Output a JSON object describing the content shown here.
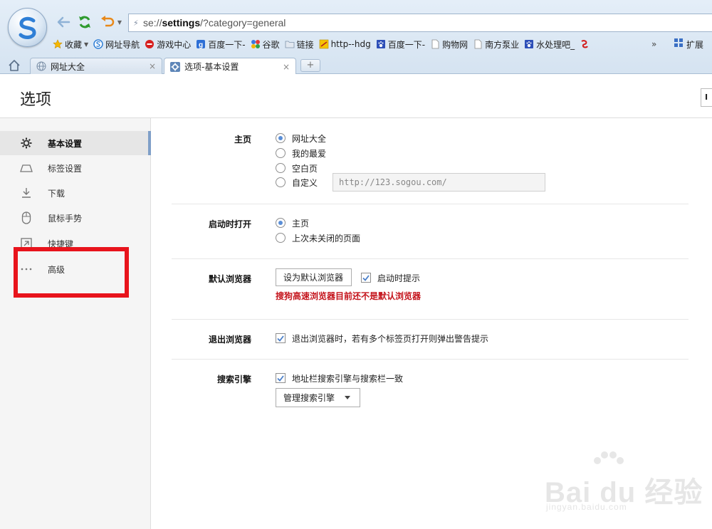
{
  "address_bar": {
    "url_prefix": "se://",
    "url_host": "settings",
    "url_path": "/?category=general"
  },
  "bookmarks": [
    {
      "label": "收藏",
      "icon": "star-icon"
    },
    {
      "label": "网址导航",
      "icon": "sogou-icon"
    },
    {
      "label": "游戏中心",
      "icon": "game-icon"
    },
    {
      "label": "百度一下-",
      "icon": "baidu-icon"
    },
    {
      "label": "谷歌",
      "icon": "google-icon"
    },
    {
      "label": "链接",
      "icon": "folder-icon"
    },
    {
      "label": "http--hdg",
      "icon": "site-icon"
    },
    {
      "label": "百度一下-",
      "icon": "baidu-paw-icon"
    },
    {
      "label": "购物网",
      "icon": "page-icon"
    },
    {
      "label": "南方泵业",
      "icon": "page-icon"
    },
    {
      "label": "水处理吧_",
      "icon": "baidu-paw-icon"
    }
  ],
  "bookmarks_more": "»",
  "extensions_label": "扩展",
  "tabs": [
    {
      "label": "网址大全",
      "icon": "globe-icon"
    },
    {
      "label": "选项-基本设置",
      "icon": "gear-icon"
    }
  ],
  "tab_close": "×",
  "new_tab": "+",
  "page": {
    "title": "选项",
    "header_box": "I"
  },
  "sidebar": {
    "items": [
      {
        "label": "基本设置",
        "icon": "gear-icon"
      },
      {
        "label": "标签设置",
        "icon": "tab-icon"
      },
      {
        "label": "下载",
        "icon": "download-icon"
      },
      {
        "label": "鼠标手势",
        "icon": "mouse-icon"
      },
      {
        "label": "快捷键",
        "icon": "shortcut-icon"
      },
      {
        "label": "高级",
        "icon": "more-dots-icon"
      }
    ]
  },
  "sections": {
    "homepage": {
      "label": "主页",
      "options": [
        "网址大全",
        "我的最爱",
        "空白页",
        "自定义"
      ],
      "custom_url": "http://123.sogou.com/"
    },
    "startup": {
      "label": "启动时打开",
      "options": [
        "主页",
        "上次未关闭的页面"
      ]
    },
    "default_browser": {
      "label": "默认浏览器",
      "button": "设为默认浏览器",
      "checkbox": "启动时提示",
      "warning": "搜狗高速浏览器目前还不是默认浏览器"
    },
    "exit_browser": {
      "label": "退出浏览器",
      "checkbox": "退出浏览器时，若有多个标签页打开则弹出警告提示"
    },
    "search_engine": {
      "label": "搜索引擎",
      "checkbox": "地址栏搜索引擎与搜索栏一致",
      "button": "管理搜索引擎"
    }
  },
  "watermark": {
    "brand": "Bai du 经验",
    "url": "jingyan.baidu.com"
  },
  "colors": {
    "accent": "#5a8ed6",
    "warning": "#c4121a",
    "highlight": "#e8141c",
    "sidebar_marker": "#7f9fc8"
  }
}
